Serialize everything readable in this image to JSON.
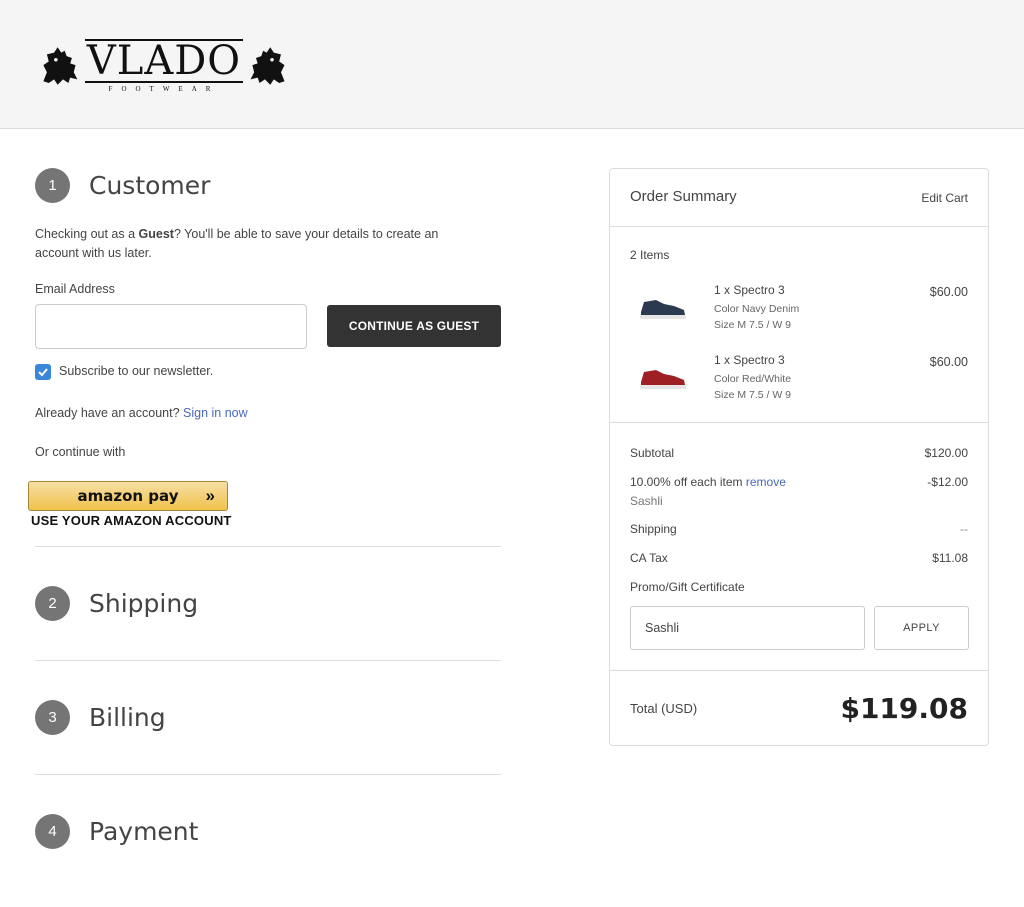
{
  "header": {
    "logo": {
      "name": "VLADO",
      "sub": "FOOTWEAR"
    }
  },
  "steps": [
    {
      "num": "1",
      "title": "Customer"
    },
    {
      "num": "2",
      "title": "Shipping"
    },
    {
      "num": "3",
      "title": "Billing"
    },
    {
      "num": "4",
      "title": "Payment"
    }
  ],
  "customer": {
    "intro_prefix": "Checking out as a ",
    "intro_bold": "Guest",
    "intro_suffix": "? You'll be able to save your details to create an",
    "intro_line2": "account with us later.",
    "email_label": "Email Address",
    "email_value": "",
    "continue_label": "CONTINUE AS GUEST",
    "newsletter_label": "Subscribe to our newsletter.",
    "newsletter_checked": true,
    "account_prompt": "Already have an account?",
    "sign_in_label": "Sign in now",
    "continue_with": "Or continue with",
    "amazon_label": "amazon pay",
    "amazon_caption": "USE YOUR AMAZON ACCOUNT"
  },
  "summary": {
    "title": "Order Summary",
    "edit_cart": "Edit Cart",
    "item_count": "2 Items",
    "items": [
      {
        "name": "1 x Spectro 3",
        "color": "Color Navy Denim",
        "size": "Size M 7.5 / W 9",
        "price": "$60.00",
        "shoe_color": "#2b3a4e"
      },
      {
        "name": "1 x Spectro 3",
        "color": "Color Red/White",
        "size": "Size M 7.5 / W 9",
        "price": "$60.00",
        "shoe_color": "#9e1f24"
      }
    ],
    "subtotal_label": "Subtotal",
    "subtotal_value": "$120.00",
    "discount_label": "10.00% off each item",
    "discount_remove": "remove",
    "discount_code": "Sashli",
    "discount_value": "-$12.00",
    "shipping_label": "Shipping",
    "shipping_value": "--",
    "tax_label": "CA Tax",
    "tax_value": "$11.08",
    "promo_link": "Promo/Gift Certificate",
    "promo_value": "Sashli",
    "apply_label": "APPLY",
    "total_label": "Total (USD)",
    "total_value": "$119.08"
  },
  "colors": {
    "accent_link": "#4a69bd",
    "button_dark": "#333333",
    "step_circle": "#757575",
    "checkbox": "#3a86d8"
  }
}
